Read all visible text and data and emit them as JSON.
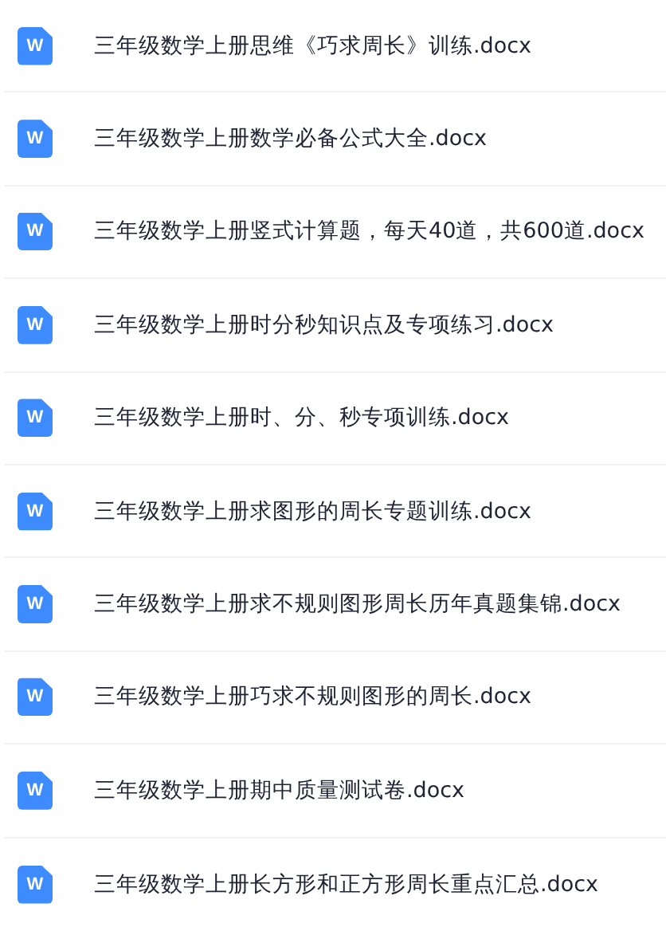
{
  "files": [
    {
      "icon_letter": "W",
      "name": "三年级数学上册思维《巧求周长》训练.docx"
    },
    {
      "icon_letter": "W",
      "name": "三年级数学上册数学必备公式大全.docx"
    },
    {
      "icon_letter": "W",
      "name": "三年级数学上册竖式计算题，每天40道，共600道.docx"
    },
    {
      "icon_letter": "W",
      "name": "三年级数学上册时分秒知识点及专项练习.docx"
    },
    {
      "icon_letter": "W",
      "name": "三年级数学上册时、分、秒专项训练.docx"
    },
    {
      "icon_letter": "W",
      "name": "三年级数学上册求图形的周长专题训练.docx"
    },
    {
      "icon_letter": "W",
      "name": "三年级数学上册求不规则图形周长历年真题集锦.docx"
    },
    {
      "icon_letter": "W",
      "name": "三年级数学上册巧求不规则图形的周长.docx"
    },
    {
      "icon_letter": "W",
      "name": "三年级数学上册期中质量测试卷.docx"
    },
    {
      "icon_letter": "W",
      "name": "三年级数学上册长方形和正方形周长重点汇总.docx"
    }
  ]
}
